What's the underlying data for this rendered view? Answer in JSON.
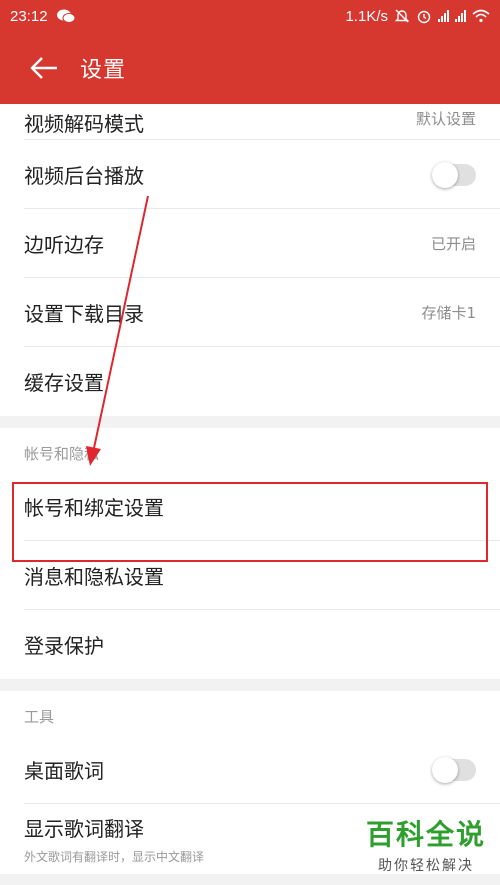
{
  "status_bar": {
    "time": "23:12",
    "speed": "1.1K/s",
    "icons": [
      "wechat-icon",
      "mute-icon",
      "alarm-icon",
      "signal-icon",
      "signal-icon",
      "wifi-icon"
    ]
  },
  "app_bar": {
    "title": "设置",
    "back_icon": "back-arrow-icon"
  },
  "section_one": {
    "items": [
      {
        "label": "视频解码模式",
        "value": "默认设置"
      },
      {
        "label": "视频后台播放",
        "toggle": false
      },
      {
        "label": "边听边存",
        "value": "已开启"
      },
      {
        "label": "设置下载目录",
        "value": "存储卡1"
      },
      {
        "label": "缓存设置"
      }
    ]
  },
  "section_account": {
    "header": "帐号和隐私",
    "items": [
      {
        "label": "帐号和绑定设置"
      },
      {
        "label": "消息和隐私设置"
      },
      {
        "label": "登录保护"
      }
    ]
  },
  "section_tools": {
    "header": "工具",
    "items": [
      {
        "label": "桌面歌词",
        "toggle": false
      },
      {
        "label": "显示歌词翻译",
        "sub": "外文歌词有翻译时，显示中文翻译"
      }
    ]
  },
  "watermark": {
    "main": "百科全说",
    "sub": "助你轻松解决"
  },
  "colors": {
    "brand_red": "#d6372f",
    "highlight_red": "#e0262f"
  }
}
